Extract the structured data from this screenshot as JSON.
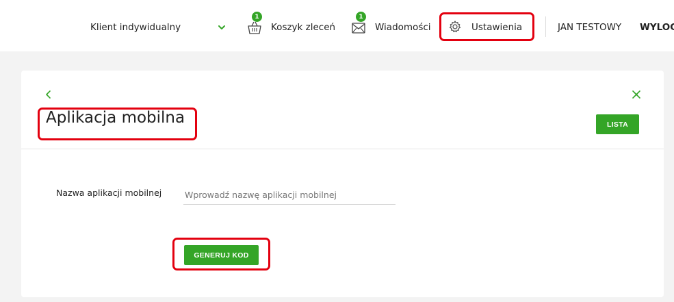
{
  "header": {
    "client_selector": "Klient indywidualny",
    "basket": {
      "label": "Koszyk zleceń",
      "badge": "1"
    },
    "messages": {
      "label": "Wiadomości",
      "badge": "1"
    },
    "settings": {
      "label": "Ustawienia"
    },
    "user_name": "JAN TESTOWY",
    "logout_label": "WYLOGU"
  },
  "page": {
    "title": "Aplikacja mobilna",
    "list_button": "LISTA"
  },
  "form": {
    "app_name_label": "Nazwa aplikacji mobilnej",
    "app_name_placeholder": "Wprowadź nazwę aplikacji mobilnej",
    "app_name_value": "",
    "generate_button": "GENERUJ KOD"
  },
  "colors": {
    "accent": "#34a527",
    "highlight": "#e3000f"
  },
  "icons": [
    "chevron-down-icon",
    "basket-icon",
    "envelope-icon",
    "gear-icon",
    "back-arrow-icon",
    "close-icon"
  ]
}
